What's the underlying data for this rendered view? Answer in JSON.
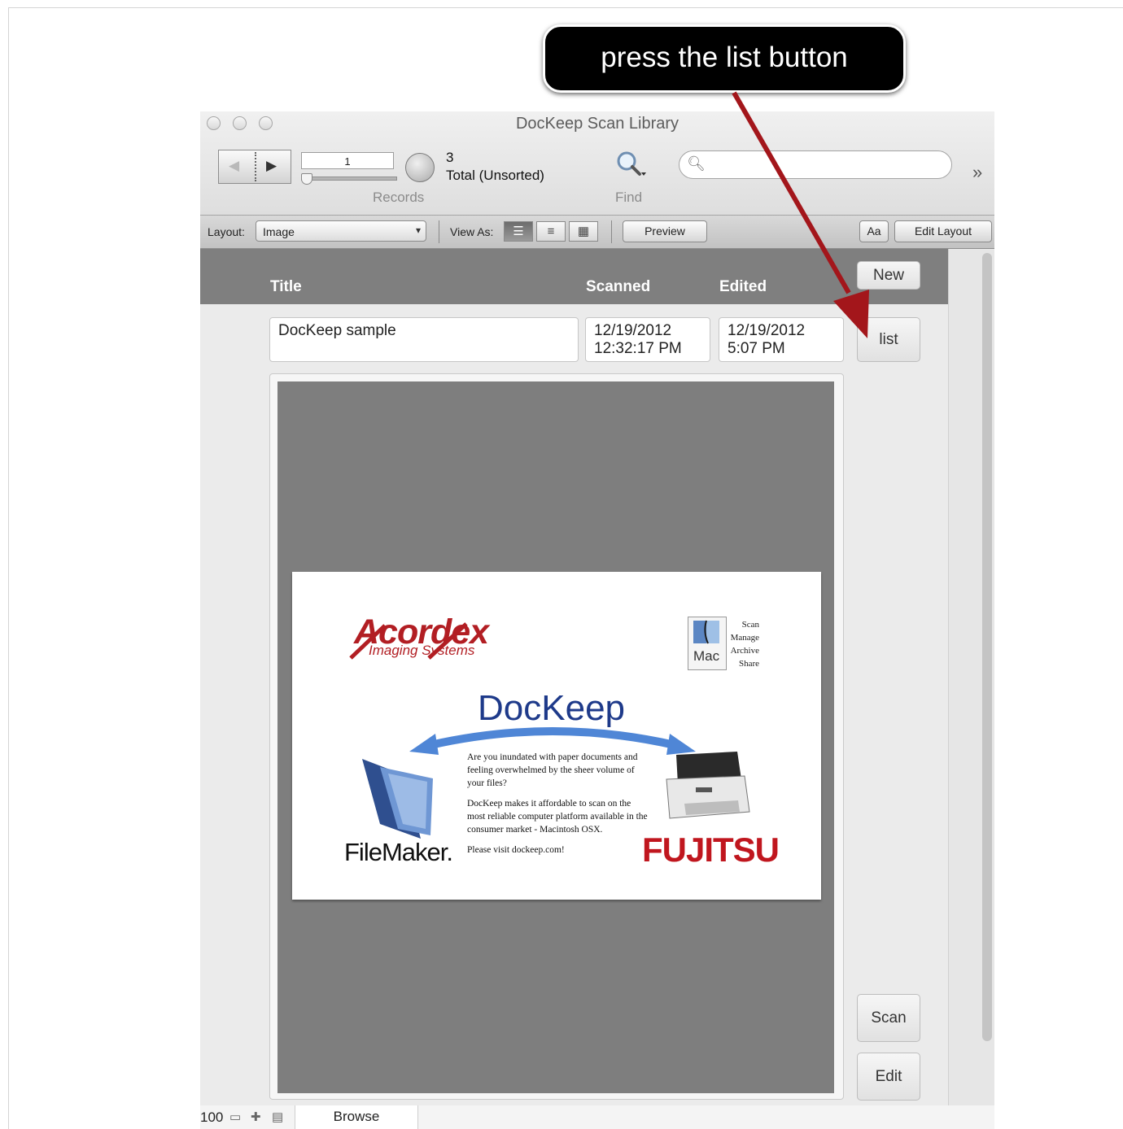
{
  "window": {
    "title": "DocKeep Scan Library"
  },
  "toolbar": {
    "record_number": "1",
    "found_count": "3",
    "found_status": "Total (Unsorted)",
    "records_label": "Records",
    "find_label": "Find",
    "search_placeholder": "",
    "more_icon": "chevron-double-right"
  },
  "layout_bar": {
    "layout_label": "Layout:",
    "layout_value": "Image",
    "view_as_label": "View As:",
    "preview_label": "Preview",
    "font_button_label": "Aa",
    "edit_layout_label": "Edit Layout"
  },
  "header": {
    "title_col": "Title",
    "scanned_col": "Scanned",
    "edited_col": "Edited"
  },
  "record": {
    "title": "DocKeep sample",
    "scanned_date": "12/19/2012",
    "scanned_time": "12:32:17 PM",
    "edited_date": "12/19/2012",
    "edited_time": "5:07 PM"
  },
  "buttons": {
    "new": "New",
    "list": "list",
    "scan": "Scan",
    "edit": "Edit"
  },
  "scan_image": {
    "acordex": "Acordex",
    "imaging_systems": "Imaging Systems",
    "mac_label": "Mac",
    "mac_list": [
      "Scan",
      "Manage",
      "Archive",
      "Share"
    ],
    "dockeep": "DocKeep",
    "blurb_1": "Are you inundated with paper documents and feeling overwhelmed by the sheer volume of your files?",
    "blurb_2": "DocKeep makes it affordable to scan on the most reliable computer platform available in the consumer market - Macintosh OSX.",
    "blurb_3": "Please visit dockeep.com!",
    "filemaker": "FileMaker.",
    "fujitsu": "FUJITSU"
  },
  "status_bar": {
    "zoom": "100",
    "mode": "Browse"
  },
  "callout": {
    "text": "press the list button"
  },
  "colors": {
    "header_band": "#7f7f7f",
    "arrow": "#a3161b",
    "acordex_red": "#b21e23",
    "dockeep_blue": "#1e3a8a",
    "fujitsu_red": "#c0161e"
  }
}
